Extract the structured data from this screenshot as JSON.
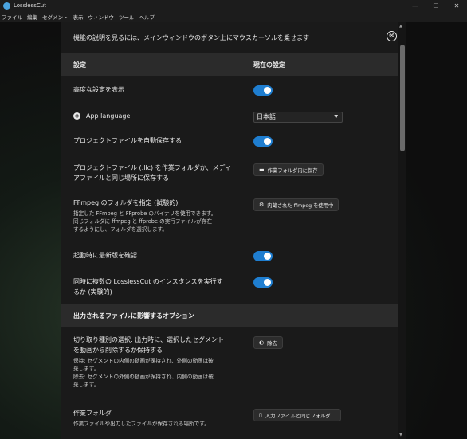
{
  "window": {
    "title": "LosslessCut",
    "controls": [
      "—",
      "☐",
      "✕"
    ]
  },
  "menu": [
    "ファイル",
    "編集",
    "セグメント",
    "表示",
    "ウィンドウ",
    "ツール",
    "ヘルプ"
  ],
  "notice": "機能の説明を見るには、メインウィンドウのボタン上にマウスカーソルを乗せます",
  "close_icon": "⊗",
  "table_header": {
    "setting": "設定",
    "current": "現在の設定"
  },
  "rows": {
    "advanced": {
      "label": "高度な設定を表示",
      "toggle": "on"
    },
    "language": {
      "label": "App language",
      "value": "日本語"
    },
    "autosave": {
      "label": "プロジェクトファイルを自動保存する",
      "toggle": "on"
    },
    "project_location": {
      "label1": "プロジェクトファイル (.llc) を作業フォルダか、メディ",
      "label2": "アファイルと同じ場所に保存する",
      "button": "作業フォルダ内に保存"
    },
    "ffmpeg": {
      "label": "FFmpeg のフォルダを指定 (試験的)",
      "desc1": "指定した FFmpeg と FFprobe のバイナリを使用できます。",
      "desc2": "同じフォルダに ffmpeg と ffprobe の実行ファイルが存在",
      "desc3": "するようにし、フォルダを選択します。",
      "button": "内蔵された ffmpeg を使用中"
    },
    "check_update": {
      "label": "起動時に最新版を確認",
      "toggle": "on"
    },
    "multi_instance": {
      "label1": "同時に複数の LosslessCut のインスタンスを実行す",
      "label2": "るか (実験的)",
      "toggle": "on"
    }
  },
  "section2": {
    "title": "出力されるファイルに影響するオプション"
  },
  "rows2": {
    "cut_mode": {
      "label1": "切り取り種別の選択: 出力時に、選択したセグメント",
      "label2": "を動画から削除するか保持する",
      "desc1": "保持: セグメントの内側の動画が保持され、外側の動画は破",
      "desc2": "棄します。",
      "desc3": "除去: セグメントの外側の動画が保持され、内側の動画は破",
      "desc4": "棄します。",
      "button": "除去"
    },
    "work_folder": {
      "label": "作業フォルダ",
      "desc": "作業ファイルや出力したファイルが保存される場所です。",
      "button": "入力ファイルと同じフォルダ..."
    }
  },
  "colors": {
    "accent": "#1f7ed0",
    "panel": "#1a1a1a",
    "header": "#2b2b2b"
  }
}
